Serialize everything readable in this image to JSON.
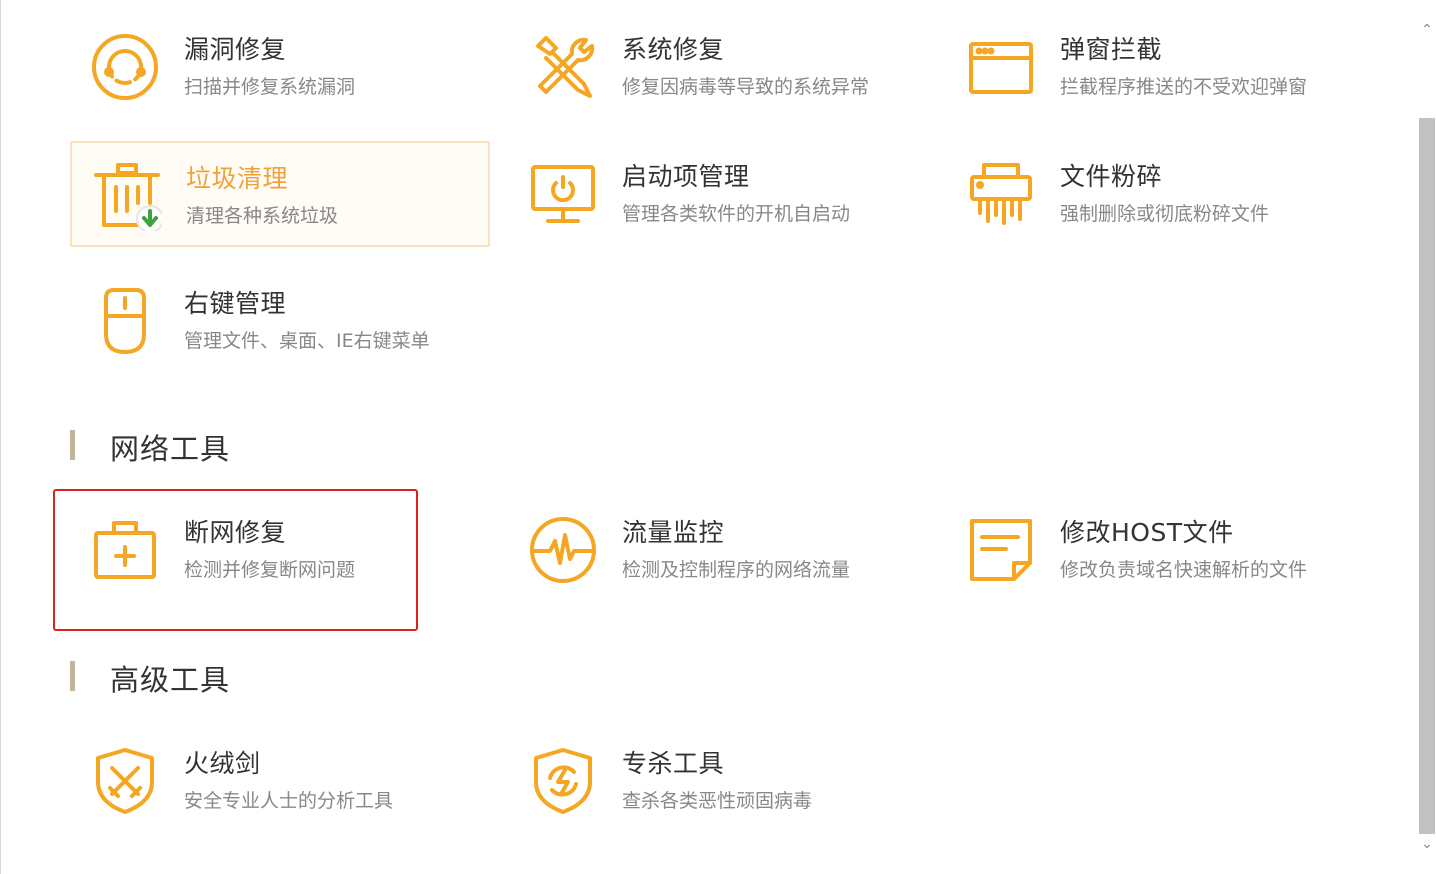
{
  "tools_row1": [
    {
      "title": "漏洞修复",
      "desc": "扫描并修复系统漏洞",
      "icon": "vulnerability-repair-icon"
    },
    {
      "title": "系统修复",
      "desc": "修复因病毒等导致的系统异常",
      "icon": "wrench-screwdriver-icon"
    },
    {
      "title": "弹窗拦截",
      "desc": "拦截程序推送的不受欢迎弹窗",
      "icon": "popup-window-icon"
    }
  ],
  "tools_row2": [
    {
      "title": "垃圾清理",
      "desc": "清理各种系统垃圾",
      "icon": "trash-download-icon"
    },
    {
      "title": "启动项管理",
      "desc": "管理各类软件的开机自启动",
      "icon": "monitor-power-icon"
    },
    {
      "title": "文件粉碎",
      "desc": "强制删除或彻底粉碎文件",
      "icon": "shredder-icon"
    }
  ],
  "tools_row3": [
    {
      "title": "右键管理",
      "desc": "管理文件、桌面、IE右键菜单",
      "icon": "mouse-icon"
    }
  ],
  "section_network": {
    "label": "网络工具"
  },
  "tools_network": [
    {
      "title": "断网修复",
      "desc": "检测并修复断网问题",
      "icon": "first-aid-kit-icon"
    },
    {
      "title": "流量监控",
      "desc": "检测及控制程序的网络流量",
      "icon": "traffic-monitor-icon"
    },
    {
      "title": "修改HOST文件",
      "desc": "修改负责域名快速解析的文件",
      "icon": "document-edit-icon"
    }
  ],
  "section_advanced": {
    "label": "高级工具"
  },
  "tools_advanced": [
    {
      "title": "火绒剑",
      "desc": "安全专业人士的分析工具",
      "icon": "shield-swords-icon"
    },
    {
      "title": "专杀工具",
      "desc": "查杀各类恶性顽固病毒",
      "icon": "shield-lightning-icon"
    }
  ],
  "colors": {
    "accent": "#f5a623",
    "highlight_border": "#fbe2c0",
    "annotation_red": "#e02020",
    "section_bar": "#c2b39b"
  }
}
